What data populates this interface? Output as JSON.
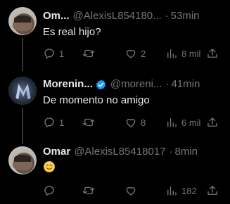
{
  "tweets": [
    {
      "name": "Om...",
      "handle": "@AlexisL854180...",
      "time": "53min",
      "text": "Es real hijo?",
      "replies": "1",
      "retweets": "",
      "likes": "2",
      "views": "8 mil"
    },
    {
      "name": "Morenin...",
      "verified": true,
      "handle": "@moreni...",
      "time": "41min",
      "text": "De momento no amigo",
      "replies": "1",
      "retweets": "",
      "likes": "8",
      "views": "6 mil"
    },
    {
      "name": "Omar",
      "handle": "@AlexisL85418017",
      "time": "8min",
      "text": "",
      "emoji": "smiling-face-with-tear",
      "replies": "",
      "retweets": "",
      "likes": "",
      "views": "182"
    }
  ],
  "colors": {
    "background": "#000000",
    "text": "#e7e9ea",
    "muted": "#71767b",
    "verified": "#1d9bf0",
    "thread_line": "#333639"
  }
}
